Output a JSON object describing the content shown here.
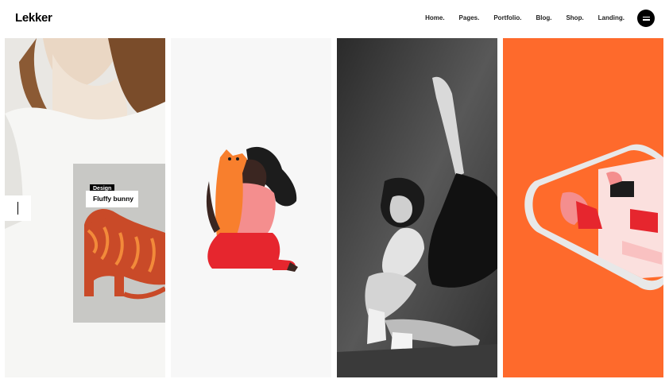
{
  "header": {
    "logo": "Lekker",
    "nav": [
      {
        "label": "Home."
      },
      {
        "label": "Pages."
      },
      {
        "label": "Portfolio."
      },
      {
        "label": "Blog."
      },
      {
        "label": "Shop."
      },
      {
        "label": "Landing."
      }
    ],
    "menu_icon": "hamburger-menu-icon"
  },
  "portfolio": {
    "hover_item": {
      "category": "Design",
      "title": "Fluffy bunny"
    }
  },
  "colors": {
    "accent": "#fe6a2c",
    "dark": "#000000",
    "light_bg": "#f7f7f7"
  }
}
